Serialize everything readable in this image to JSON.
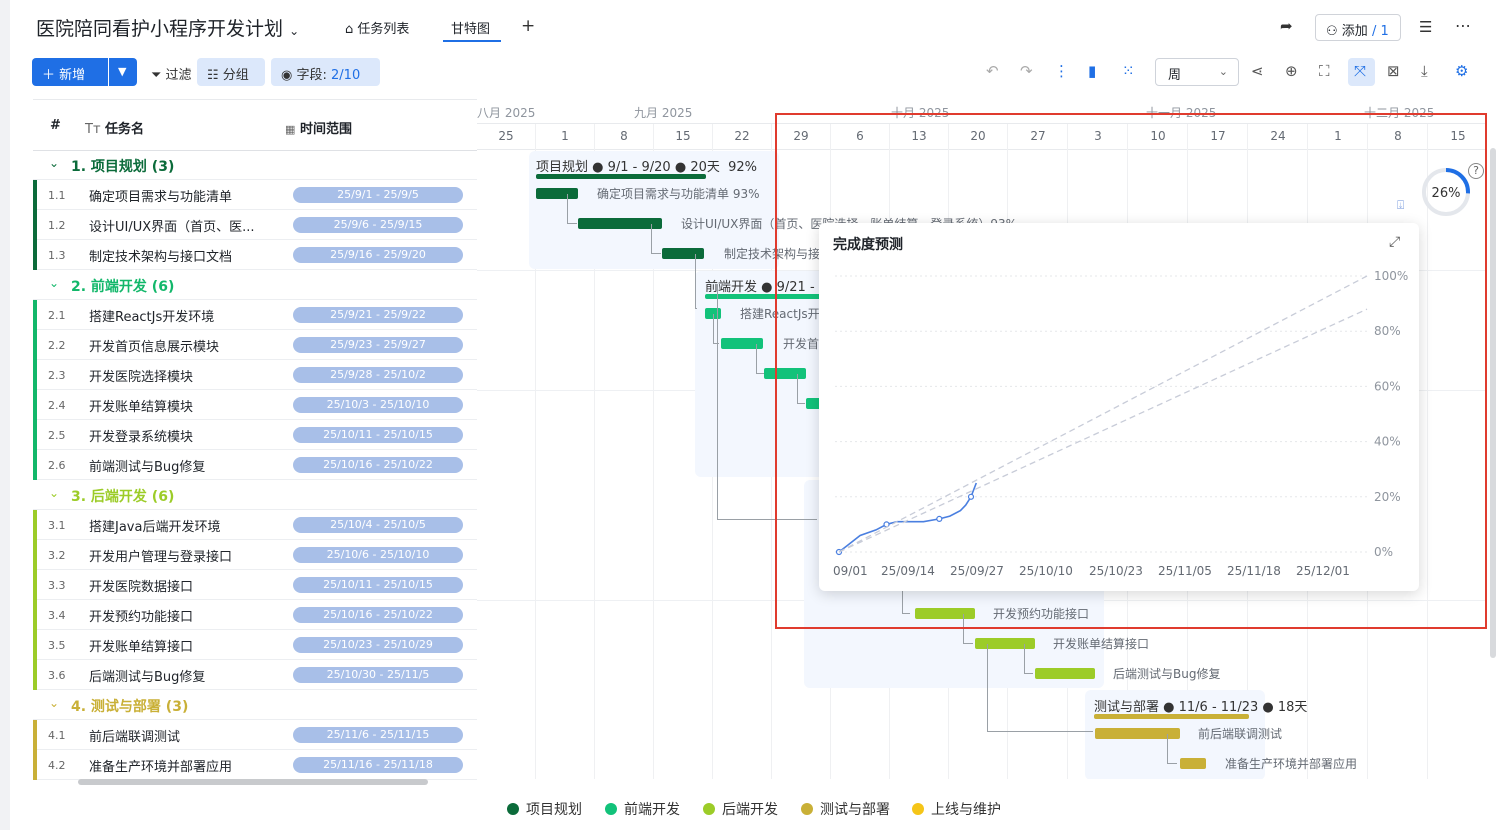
{
  "header": {
    "title": "医院陪同看护小程序开发计划",
    "tabs": [
      {
        "label": "任务列表"
      },
      {
        "label": "甘特图"
      }
    ],
    "add_label": "添加",
    "add_count": "/ 1"
  },
  "toolbar": {
    "new_label": "新增",
    "filter_label": "过滤",
    "group_label": "分组",
    "fields_label": "字段:",
    "fields_count": "2/10",
    "view_select": "周"
  },
  "grid": {
    "col_num": "#",
    "col_name": "任务名",
    "col_range": "时间范围",
    "groups": [
      {
        "title": "1. 项目规划 (3)",
        "color": "#0b6b3a",
        "tasks": [
          {
            "num": "1.1",
            "name": "确定项目需求与功能清单",
            "range": "25/9/1 - 25/9/5"
          },
          {
            "num": "1.2",
            "name": "设计UI/UX界面（首页、医...",
            "range": "25/9/6 - 25/9/15"
          },
          {
            "num": "1.3",
            "name": "制定技术架构与接口文档",
            "range": "25/9/16 - 25/9/20"
          }
        ]
      },
      {
        "title": "2. 前端开发 (6)",
        "color": "#12b76a",
        "tasks": [
          {
            "num": "2.1",
            "name": "搭建ReactJs开发环境",
            "range": "25/9/21 - 25/9/22"
          },
          {
            "num": "2.2",
            "name": "开发首页信息展示模块",
            "range": "25/9/23 - 25/9/27"
          },
          {
            "num": "2.3",
            "name": "开发医院选择模块",
            "range": "25/9/28 - 25/10/2"
          },
          {
            "num": "2.4",
            "name": "开发账单结算模块",
            "range": "25/10/3 - 25/10/10"
          },
          {
            "num": "2.5",
            "name": "开发登录系统模块",
            "range": "25/10/11 - 25/10/15"
          },
          {
            "num": "2.6",
            "name": "前端测试与Bug修复",
            "range": "25/10/16 - 25/10/22"
          }
        ]
      },
      {
        "title": "3. 后端开发 (6)",
        "color": "#9ccc28",
        "tasks": [
          {
            "num": "3.1",
            "name": "搭建Java后端开发环境",
            "range": "25/10/4 - 25/10/5"
          },
          {
            "num": "3.2",
            "name": "开发用户管理与登录接口",
            "range": "25/10/6 - 25/10/10"
          },
          {
            "num": "3.3",
            "name": "开发医院数据接口",
            "range": "25/10/11 - 25/10/15"
          },
          {
            "num": "3.4",
            "name": "开发预约功能接口",
            "range": "25/10/16 - 25/10/22"
          },
          {
            "num": "3.5",
            "name": "开发账单结算接口",
            "range": "25/10/23 - 25/10/29"
          },
          {
            "num": "3.6",
            "name": "后端测试与Bug修复",
            "range": "25/10/30 - 25/11/5"
          }
        ]
      },
      {
        "title": "4. 测试与部署 (3)",
        "color": "#c9b037",
        "tasks": [
          {
            "num": "4.1",
            "name": "前后端联调测试",
            "range": "25/11/6 - 25/11/15"
          },
          {
            "num": "4.2",
            "name": "准备生产环境并部署应用",
            "range": "25/11/16 - 25/11/18"
          }
        ]
      }
    ]
  },
  "timeline": {
    "months": [
      "八月 2025",
      "九月 2025",
      "十月 2025",
      "十一月 2025",
      "十二月 2025"
    ],
    "weeks": [
      "25",
      "1",
      "8",
      "15",
      "22",
      "29",
      "6",
      "13",
      "20",
      "27",
      "3",
      "10",
      "17",
      "24",
      "1",
      "8",
      "15"
    ],
    "summaries": [
      {
        "label": "项目规划",
        "range": "9/1 - 9/20",
        "days": "20天",
        "pct": "92%"
      },
      {
        "label": "前端开发",
        "range": "9/21 -"
      },
      {
        "label": "测试与部署",
        "range": "11/6 - 11/23",
        "days": "18天"
      }
    ],
    "bar_labels": [
      "确定项目需求与功能清单 93%",
      "设计UI/UX界面（首页、医院选择、账单结算、登录系统）93%",
      "制定技术架构与接",
      "搭建ReactJs开",
      "开发首",
      "开发预约功能接口",
      "开发账单结算接口",
      "后端测试与Bug修复",
      "前后端联调测试",
      "准备生产环境并部署应用"
    ],
    "progress_ring": "26%"
  },
  "popup": {
    "title": "完成度预测"
  },
  "chart_data": {
    "type": "line",
    "title": "",
    "x_ticks": [
      "09/01",
      "25/09/14",
      "25/09/27",
      "25/10/10",
      "25/10/23",
      "25/11/05",
      "25/11/18",
      "25/12/01"
    ],
    "y_ticks": [
      "0%",
      "20%",
      "40%",
      "60%",
      "80%",
      "100%"
    ],
    "ylim": [
      0,
      100
    ],
    "xlim": [
      "2025-09-01",
      "2025-12-10"
    ],
    "series": [
      {
        "name": "",
        "style": "solid",
        "color": "#4a7fe0",
        "points": [
          [
            "2025-09-01",
            0
          ],
          [
            "2025-09-03",
            3
          ],
          [
            "2025-09-05",
            6
          ],
          [
            "2025-09-08",
            8
          ],
          [
            "2025-09-10",
            10
          ],
          [
            "2025-09-12",
            11
          ],
          [
            "2025-09-14",
            11
          ],
          [
            "2025-09-17",
            11
          ],
          [
            "2025-09-20",
            12
          ],
          [
            "2025-09-22",
            13
          ],
          [
            "2025-09-24",
            15
          ],
          [
            "2025-09-25",
            17
          ],
          [
            "2025-09-26",
            20
          ],
          [
            "2025-09-27",
            25
          ]
        ]
      },
      {
        "name": "",
        "style": "dashed",
        "color": "#c8ccd8",
        "points": [
          [
            "2025-09-01",
            0
          ],
          [
            "2025-12-10",
            100
          ]
        ]
      },
      {
        "name": "",
        "style": "dashed",
        "color": "#c8ccd8",
        "points": [
          [
            "2025-09-01",
            0
          ],
          [
            "2025-12-10",
            88
          ]
        ]
      }
    ]
  },
  "legend": [
    {
      "label": "项目规划",
      "color": "#0b6b3a"
    },
    {
      "label": "前端开发",
      "color": "#12c27a"
    },
    {
      "label": "后端开发",
      "color": "#9ccc28"
    },
    {
      "label": "测试与部署",
      "color": "#c9b037"
    },
    {
      "label": "上线与维护",
      "color": "#f5c518"
    }
  ]
}
